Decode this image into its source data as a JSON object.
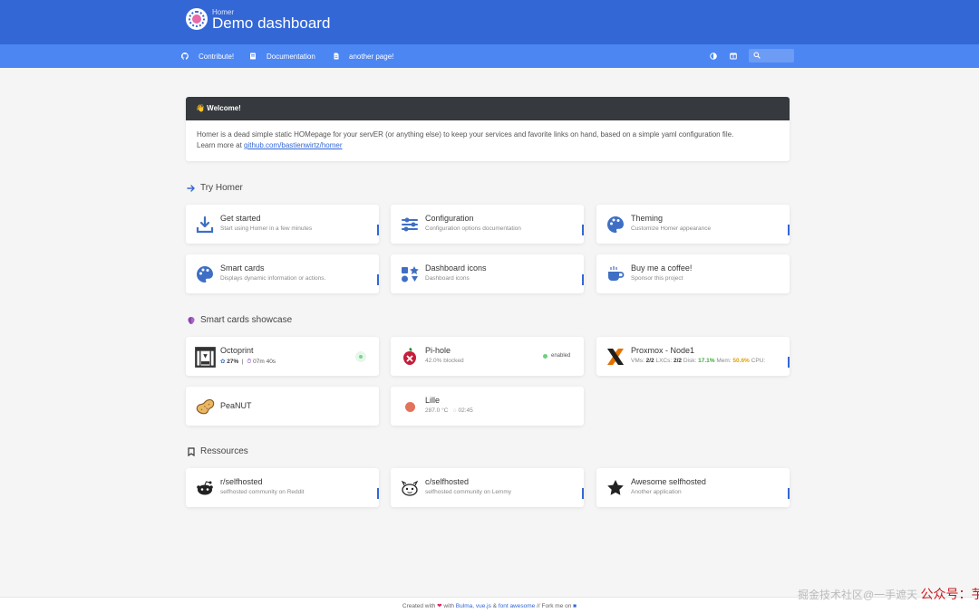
{
  "header": {
    "subtitle": "Homer",
    "title": "Demo dashboard",
    "logo": "donut-logo"
  },
  "navbar": {
    "links": [
      {
        "label": "Contribute!",
        "icon": "github-icon"
      },
      {
        "label": "Documentation",
        "icon": "book-icon"
      },
      {
        "label": "another page!",
        "icon": "file-icon"
      }
    ],
    "right_icons": [
      "theme-toggle-icon",
      "layout-toggle-icon",
      "search-icon"
    ]
  },
  "message": {
    "title": "👋 Welcome!",
    "text": "Homer is a dead simple static HOMepage for your servER (or anything else) to keep your services and favorite links on hand, based on a simple yaml configuration file.",
    "learn_prefix": "Learn more at ",
    "learn_link": "github.com/bastienwirtz/homer"
  },
  "sections": {
    "try_homer": {
      "title": "Try Homer",
      "icon": "arrow-right-icon"
    },
    "smart": {
      "title": "Smart cards showcase",
      "icon": "brain-icon"
    },
    "ress": {
      "title": "Ressources",
      "icon": "bookmark-icon"
    }
  },
  "cards": {
    "get_started": {
      "title": "Get started",
      "sub": "Start using Homer in a few minutes"
    },
    "configuration": {
      "title": "Configuration",
      "sub": "Configuration options documentation"
    },
    "theming": {
      "title": "Theming",
      "sub": "Customize Homer appearance"
    },
    "smart_cards": {
      "title": "Smart cards",
      "sub": "Displays dynamic information or actions."
    },
    "dashboard_icons": {
      "title": "Dashboard icons",
      "sub": "Dashboard icons"
    },
    "coffee": {
      "title": "Buy me a coffee!",
      "sub": "Sponsor this project"
    },
    "octoprint": {
      "title": "Octoprint",
      "progress": "27%",
      "sep": "|",
      "time": "07m 40s"
    },
    "pihole": {
      "title": "Pi-hole",
      "sub": "42.0% blocked",
      "status": "enabled"
    },
    "proxmox": {
      "title": "Proxmox - Node1",
      "vms_label": "VMs: ",
      "vms": "2/2",
      "lxcs_label": " LXCs: ",
      "lxcs": "2/2",
      "disk_label": " Disk: ",
      "disk": "17.1%",
      "mem_label": " Mem: ",
      "mem": "50.6%",
      "cpu_label": " CPU:"
    },
    "peanut": {
      "title": "PeaNUT"
    },
    "lille": {
      "title": "Lille",
      "temp": "287.0 °C",
      "time": "02:45"
    },
    "selfhosted_reddit": {
      "title": "r/selfhosted",
      "sub": "selfhosted community on Reddit"
    },
    "selfhosted_lemmy": {
      "title": "c/selfhosted",
      "sub": "selfhosted community on Lemmy"
    },
    "awesome": {
      "title": "Awesome selfhosted",
      "sub": "Another application"
    }
  },
  "footer": {
    "created": "Created with ",
    "with": " with ",
    "bulma": "Bulma",
    "vue": "vue.js",
    "amp": " & ",
    "fa": "font awesome",
    "fork": " // Fork me on "
  },
  "watermark": {
    "left": "掘金技术社区@一手遮天",
    "right": "公众号：芋道源码"
  },
  "colors": {
    "header": "#3367d6",
    "navbar": "#4c86f3",
    "accent": "#3367d6",
    "message_head": "#363a3f",
    "background": "#f5f5f5"
  }
}
